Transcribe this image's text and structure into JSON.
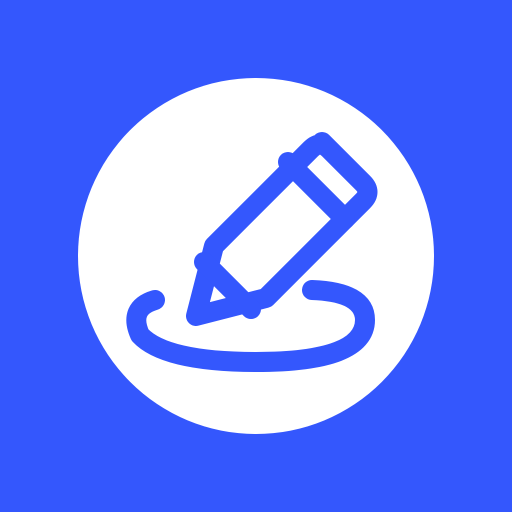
{
  "icon": {
    "name": "pencil-edit-app-icon",
    "colors": {
      "background": "#3457FD",
      "circle": "#FFFFFF",
      "glyph": "#3457FD"
    }
  }
}
